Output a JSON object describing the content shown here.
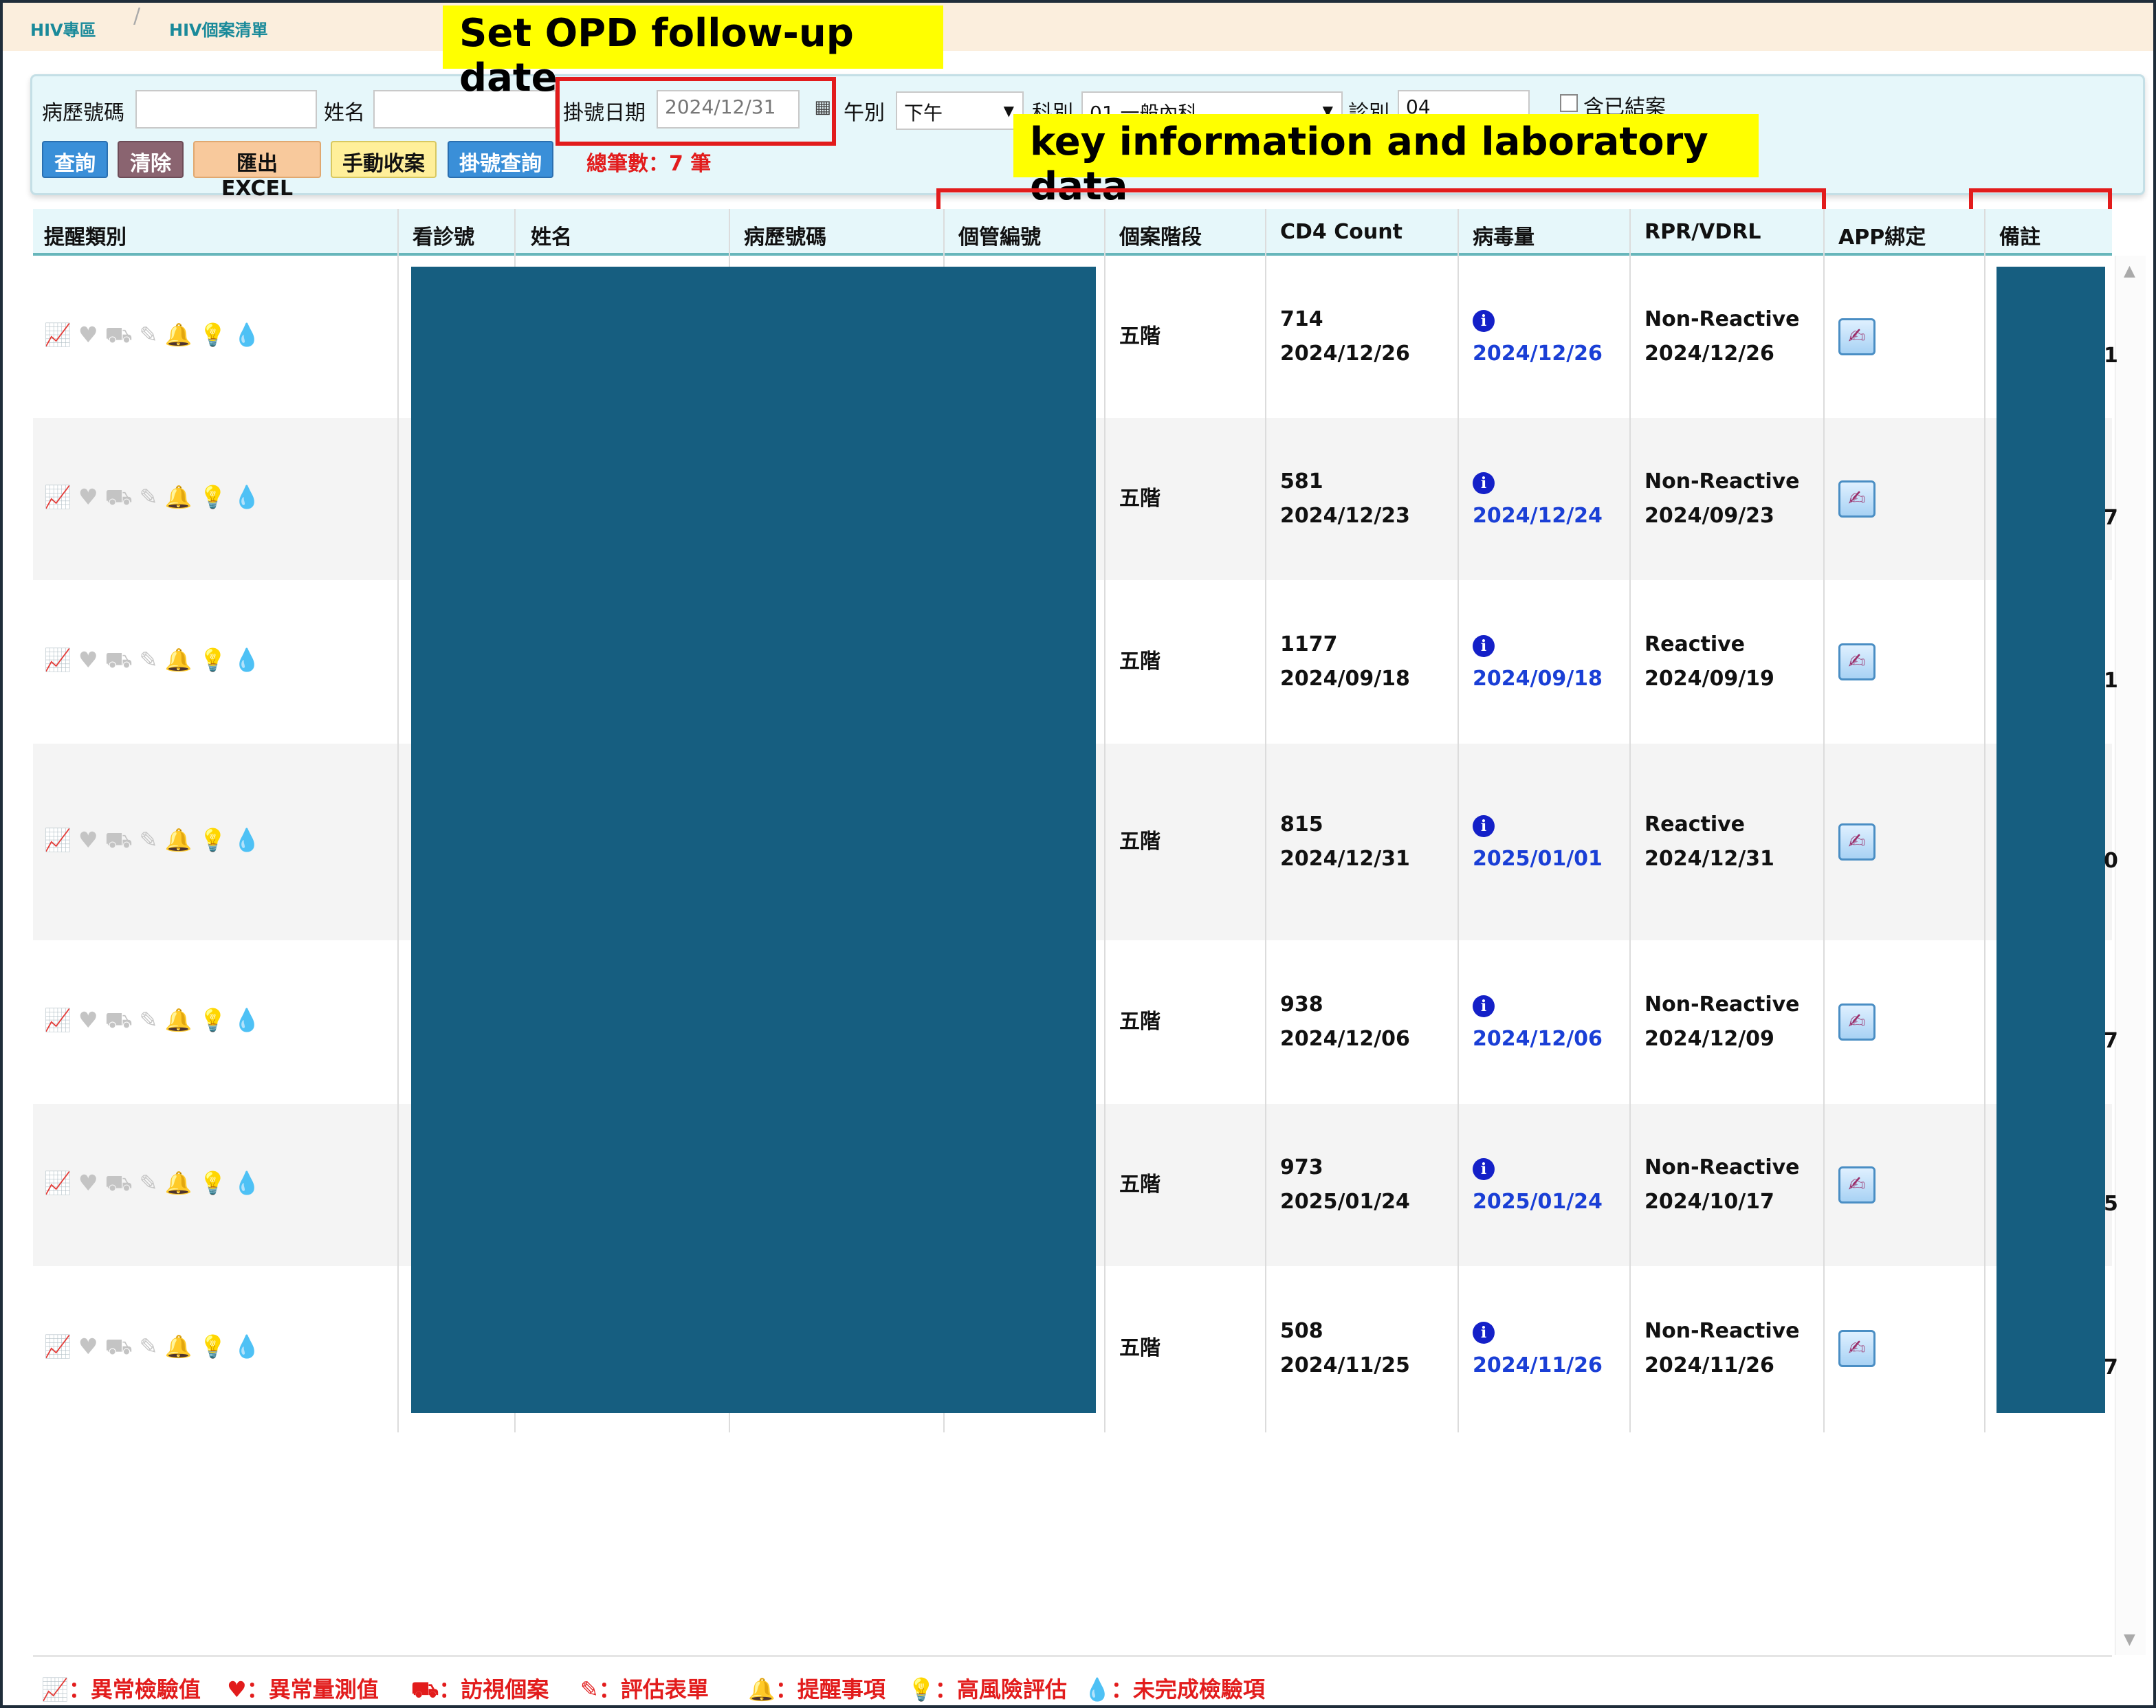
{
  "breadcrumb": {
    "items": [
      "HIV專區",
      "HIV個案清單"
    ]
  },
  "search": {
    "chart_no_label": "病歷號碼",
    "chart_no_value": "",
    "name_label": "姓名",
    "name_value": "",
    "reg_date_label": "掛號日期",
    "reg_date_value": "2024/12/31",
    "session_label": "午別",
    "session_value": "下午",
    "dept_label": "科別",
    "dept_value": "01 一般內科",
    "clinic_label": "診別",
    "clinic_value": "04",
    "closed_label": "含已結案"
  },
  "buttons": {
    "query": "查詢",
    "clear": "清除",
    "export": "匯出EXCEL",
    "manual_close": "手動收案",
    "reg_query": "掛號查詢"
  },
  "total_text": "總筆數：7 筆",
  "annotations": {
    "opd": "Set OPD follow-up date",
    "key": "key information and laboratory data"
  },
  "table": {
    "headers": [
      "提醒類別",
      "看診號",
      "姓名",
      "病歷號碼",
      "個管編號",
      "個案階段",
      "CD4 Count",
      "病毒量",
      "RPR/VDRL",
      "APP綁定",
      "備註"
    ],
    "rows": [
      {
        "stage": "五階",
        "cd4": "714",
        "cd4_date": "2024/12/26",
        "vl_date": "2024/12/26",
        "rpr": "Non-Reactive",
        "rpr_date": "2024/12/26",
        "note_tail": "1",
        "risk": false
      },
      {
        "stage": "五階",
        "cd4": "581",
        "cd4_date": "2024/12/23",
        "vl_date": "2024/12/24",
        "rpr": "Non-Reactive",
        "rpr_date": "2024/09/23",
        "note_tail": "7",
        "risk": true
      },
      {
        "stage": "五階",
        "cd4": "1177",
        "cd4_date": "2024/09/18",
        "vl_date": "2024/09/18",
        "rpr": "Reactive",
        "rpr_date": "2024/09/19",
        "note_tail": "1",
        "risk": false
      },
      {
        "stage": "五階",
        "cd4": "815",
        "cd4_date": "2024/12/31",
        "vl_date": "2025/01/01",
        "rpr": "Reactive",
        "rpr_date": "2024/12/31",
        "note_tail": "0",
        "risk": true
      },
      {
        "stage": "五階",
        "cd4": "938",
        "cd4_date": "2024/12/06",
        "vl_date": "2024/12/06",
        "rpr": "Non-Reactive",
        "rpr_date": "2024/12/09",
        "note_tail": "7",
        "risk": false
      },
      {
        "stage": "五階",
        "cd4": "973",
        "cd4_date": "2025/01/24",
        "vl_date": "2025/01/24",
        "rpr": "Non-Reactive",
        "rpr_date": "2024/10/17",
        "note_tail": "5",
        "risk": true
      },
      {
        "stage": "五階",
        "cd4": "508",
        "cd4_date": "2024/11/25",
        "vl_date": "2024/11/26",
        "rpr": "Non-Reactive",
        "rpr_date": "2024/11/26",
        "note_tail": "7",
        "risk": true
      }
    ]
  },
  "legend": [
    {
      "icon": "chart-line-icon",
      "text": "：異常檢驗值"
    },
    {
      "icon": "heart-icon",
      "text": "：異常量測值"
    },
    {
      "icon": "visit-icon",
      "text": "：訪視個案"
    },
    {
      "icon": "form-icon",
      "text": "：評估表單"
    },
    {
      "icon": "bell-icon",
      "text": "：提醒事項"
    },
    {
      "icon": "lightbulb-icon",
      "text": "：高風險評估"
    },
    {
      "icon": "drop-icon",
      "text": "：未完成檢驗項"
    }
  ],
  "colors": {
    "accent": "#e21c1c",
    "header_bg": "#e6f7fa",
    "mask": "#165e80",
    "link": "#1a3fd6"
  }
}
